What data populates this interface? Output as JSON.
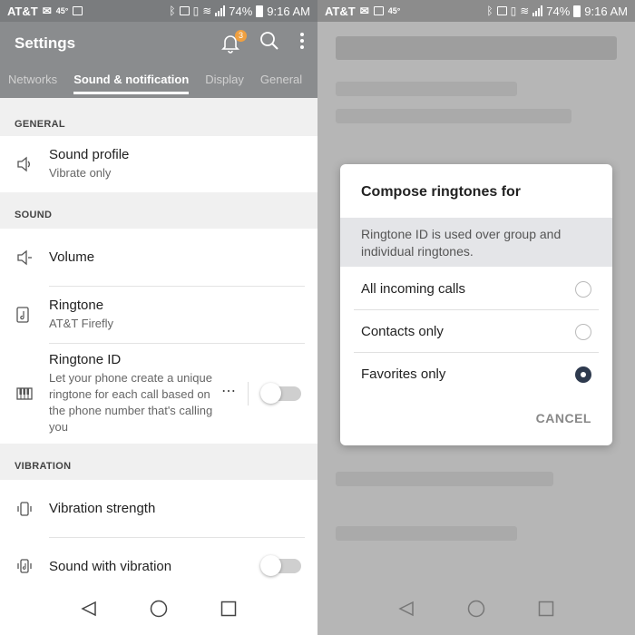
{
  "status_left": {
    "carrier": "AT&T",
    "temperature": "45°",
    "battery": "74%",
    "time": "9:16 AM"
  },
  "status_right": {
    "carrier": "AT&T",
    "temperature": "45°",
    "battery": "74%",
    "time": "9:16 AM"
  },
  "appbar": {
    "title": "Settings",
    "notification_count": "3"
  },
  "tabs": [
    "Networks",
    "Sound & notification",
    "Display",
    "General"
  ],
  "sections": {
    "general": "GENERAL",
    "sound": "SOUND",
    "vibration": "VIBRATION"
  },
  "items": {
    "sound_profile": {
      "title": "Sound profile",
      "subtitle": "Vibrate only"
    },
    "volume": {
      "title": "Volume"
    },
    "ringtone": {
      "title": "Ringtone",
      "subtitle": "AT&T Firefly"
    },
    "ringtone_id": {
      "title": "Ringtone ID",
      "subtitle": "Let your phone create a unique ringtone for each call based on the phone number that's calling you",
      "enabled": false
    },
    "vibration_strength": {
      "title": "Vibration strength"
    },
    "sound_with_vibration": {
      "title": "Sound with vibration",
      "enabled": false
    }
  },
  "dialog": {
    "title": "Compose ringtones for",
    "info": "Ringtone ID is used over group and individual ringtones.",
    "options": [
      {
        "label": "All incoming calls",
        "selected": false
      },
      {
        "label": "Contacts only",
        "selected": false
      },
      {
        "label": "Favorites only",
        "selected": true
      }
    ],
    "cancel_label": "CANCEL"
  },
  "icons": {
    "bell": "bell-icon",
    "search": "search-icon",
    "overflow": "overflow-menu-icon",
    "back": "back-icon",
    "home": "home-icon",
    "recents": "recents-icon"
  },
  "colors": {
    "appbar": "#8a8c8e",
    "badge": "#f0a040",
    "radio_selected": "#2e3a4e"
  }
}
